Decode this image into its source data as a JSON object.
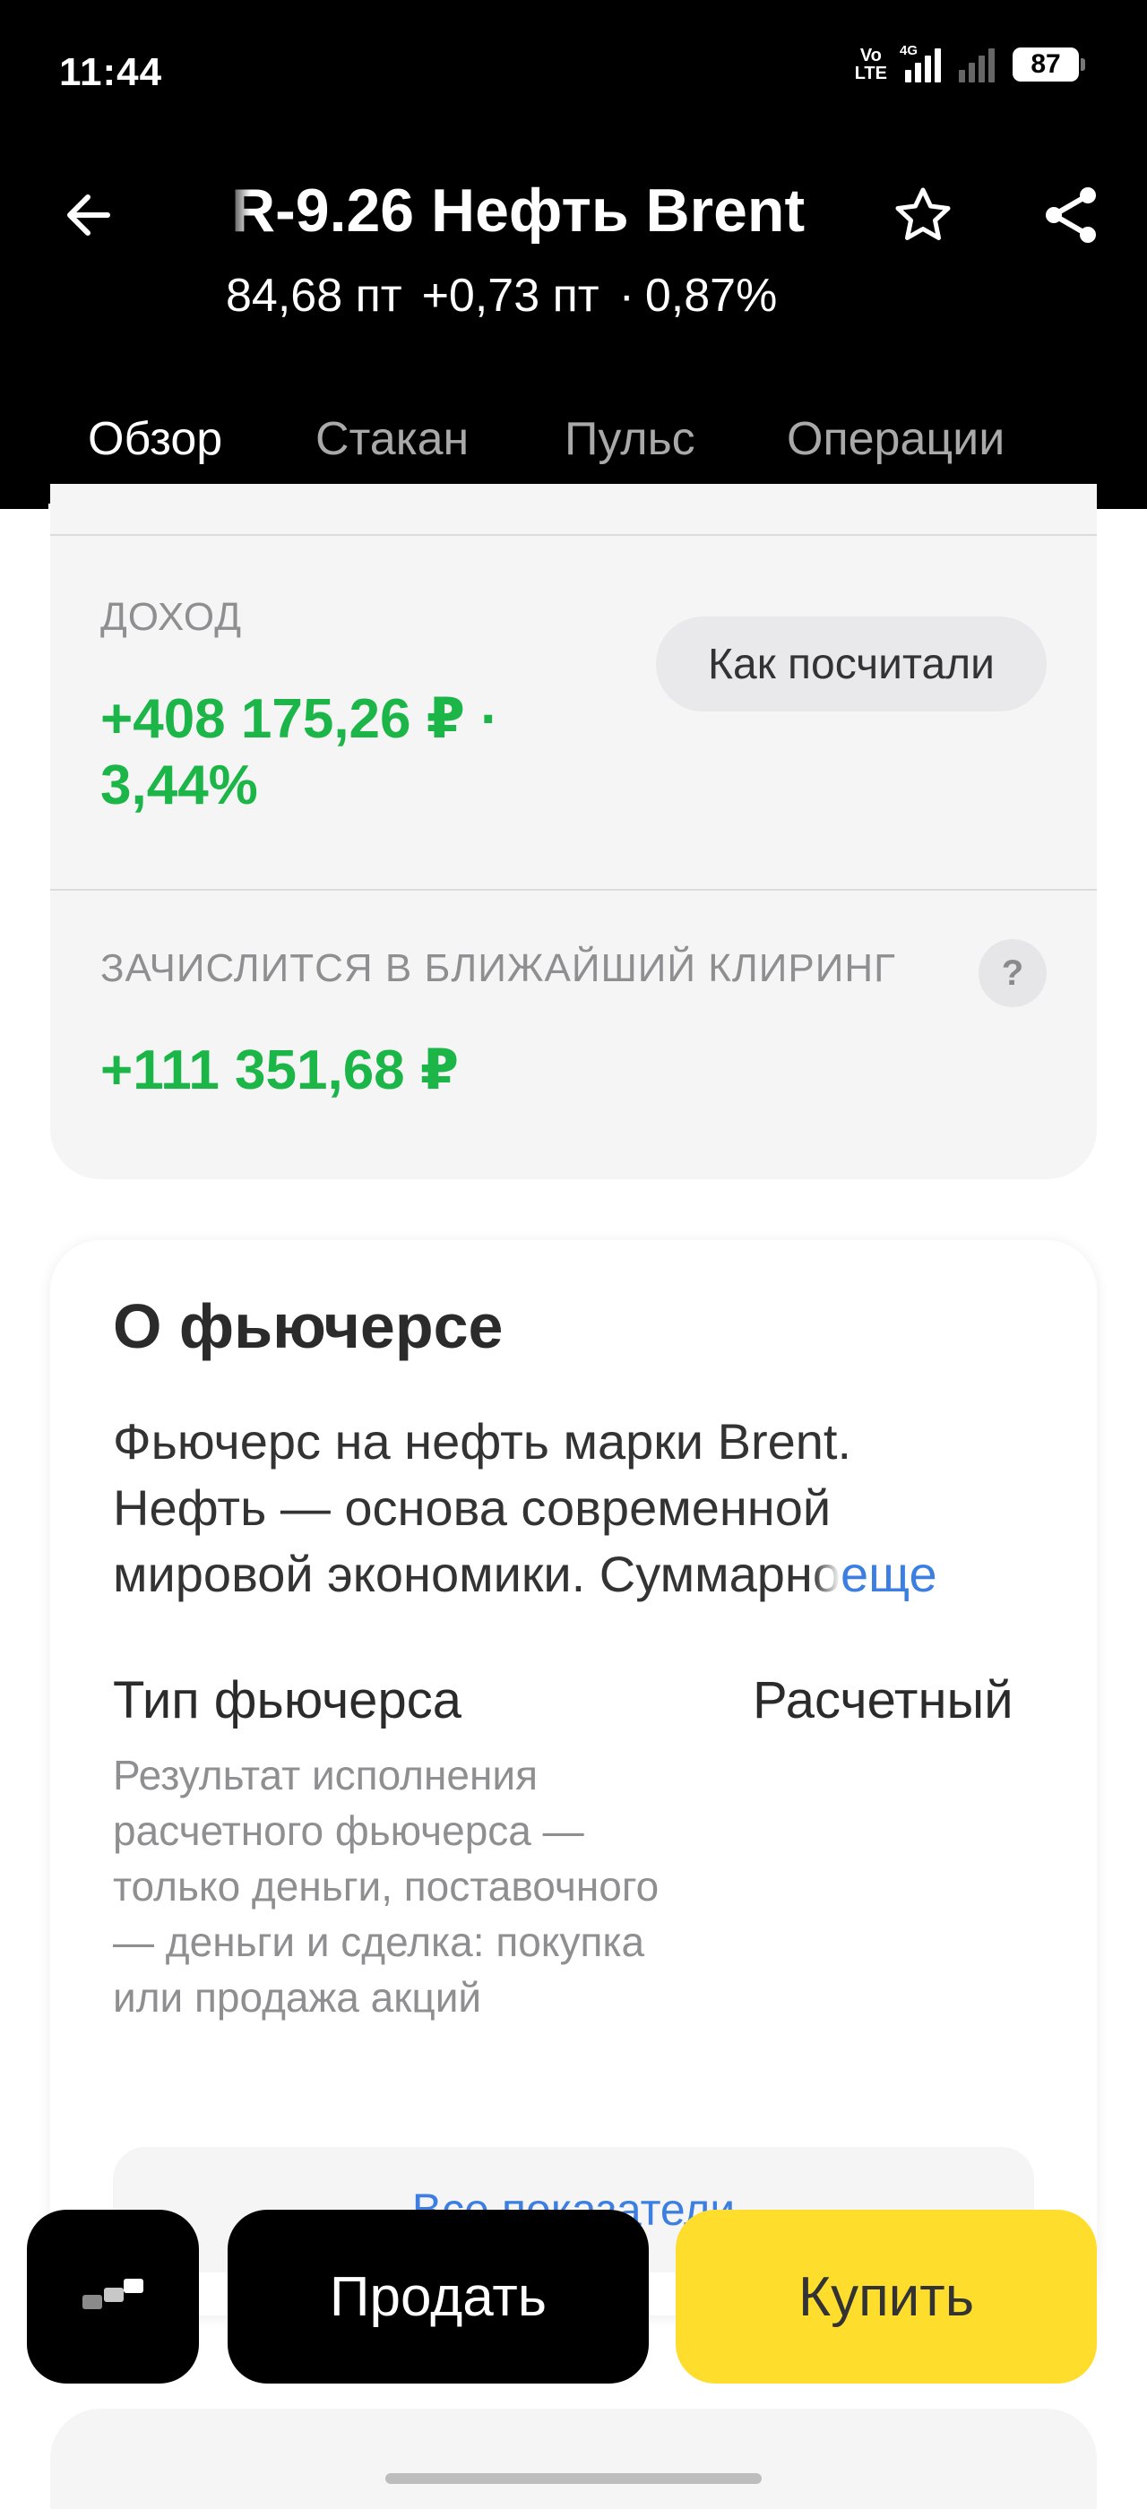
{
  "status_bar": {
    "time": "11:44",
    "volte_top": "Vo",
    "volte_bottom": "LTE",
    "network_label": "4G",
    "battery": "87"
  },
  "header": {
    "title": "R-9.26 Нефть Brent",
    "price": "84,68 пт",
    "change": "+0,73 пт",
    "separator": "·",
    "change_pct": "0,87%",
    "icons": {
      "back": "arrow-left-icon",
      "favorite": "star-icon",
      "share": "share-icon"
    }
  },
  "tabs": [
    {
      "label": "Обзор",
      "active": true
    },
    {
      "label": "Стакан",
      "active": false
    },
    {
      "label": "Пульс",
      "active": false
    },
    {
      "label": "Операции",
      "active": false
    }
  ],
  "income": {
    "label": "ДОХОД",
    "amount_line1": "+408 175,26 ₽ ·",
    "amount_line2": "3,44%",
    "calc_button": "Как посчитали",
    "clearing_label": "ЗАЧИСЛИТСЯ В БЛИЖАЙШИЙ КЛИРИНГ",
    "clearing_help": "?",
    "clearing_amount": "+111 351,68 ₽"
  },
  "about": {
    "title": "О фьючерсе",
    "desc_line1": "Фьючерс на нефть марки Brent.",
    "desc_line2": "Нефть — основа современной",
    "desc_line3": "мировой экономики. Суммарн",
    "desc_fade": "о",
    "more": "еще",
    "type_label": "Тип фьючерса",
    "type_value": "Расчетный",
    "type_hint": "Результат исполнения расчетного фьючерса — только деньги, поставочного — деньги и сделка: покупка или продажа акций",
    "all_indicators": "Все показатели"
  },
  "actions": {
    "menu_icon": "terminal-icon",
    "sell": "Продать",
    "buy": "Купить"
  },
  "colors": {
    "accent_green": "#1bb548",
    "buy_yellow": "#ffdd2d",
    "link_blue": "#3d7fe0"
  }
}
